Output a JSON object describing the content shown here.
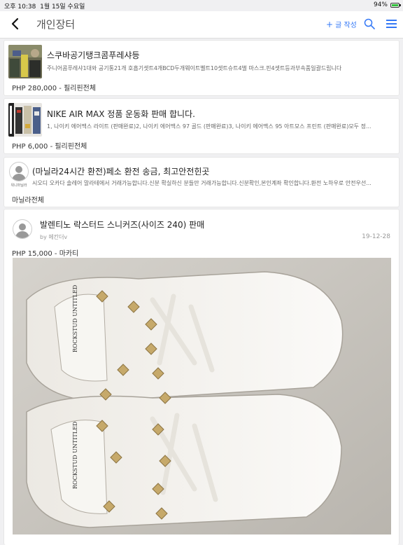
{
  "status": {
    "time": "오후 10:38",
    "date": "1월 15일 수요일",
    "battery": "94%"
  },
  "nav": {
    "title": "개인장터",
    "write_label": "글 작성",
    "write_plus": "+"
  },
  "listings": [
    {
      "title": "스쿠바공기탱크콤푸레샤등",
      "desc": "주니어콤푸레샤1대와 공기통21개 호흡기셋트4개BCD두개웨이트벨트10셋트슈트4벌 마스크.핀4셋트등과부속품일괄드립니다",
      "price": "PHP 280,000 - 필리핀전체"
    },
    {
      "title": "NIKE AIR MAX 정품 운동화 판매 합니다.",
      "desc": "1, 나이키 에어맥스 라이트 (판매완료)2, 나이키 에어맥스 97 골드 (판매완료)3, 나이키 에어맥스 95 아트모스 프린트 (판매완료)모두 정...",
      "price": "PHP 6,000 - 필리핀전체"
    },
    {
      "title": "(마닐라24시간 환전)페소 환전 송금, 최고안전힌곳",
      "desc": "시오디 오카다 솔레어 말라테에서 거래가능합니다.신분 확실하신 분들만 거래가능합니다.신분확인,본인계좌 확인합니다.환전 노하우로 안전우선...",
      "price": "마닐라전체",
      "avatar_name": "위니마닐라"
    }
  ],
  "detail": {
    "title": "발렌티노 락스터드 스니커즈(사이즈 240) 판매",
    "author": "by 메칸더v",
    "date": "19-12-28",
    "price": "PHP 15,000 - 마카티",
    "photo_text": "ROCKSTUD UNTITLED"
  },
  "icons": [
    "back-icon",
    "search-icon",
    "menu-icon",
    "avatar-icon"
  ],
  "colors": {
    "accent": "#3478f6",
    "background": "#f0f0f2"
  }
}
